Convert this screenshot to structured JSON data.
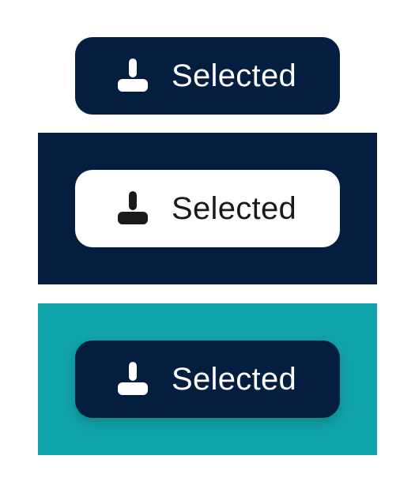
{
  "chips": [
    {
      "label": "Selected",
      "icon": "user-icon",
      "variant": "dark",
      "background": "#ffffff"
    },
    {
      "label": "Selected",
      "icon": "user-icon",
      "variant": "light",
      "background": "#031e3e"
    },
    {
      "label": "Selected",
      "icon": "user-icon",
      "variant": "dark",
      "background": "#11a3aa"
    }
  ],
  "colors": {
    "navy": "#031e3e",
    "teal": "#11a3aa",
    "white": "#ffffff",
    "ink": "#1a1a1a"
  }
}
